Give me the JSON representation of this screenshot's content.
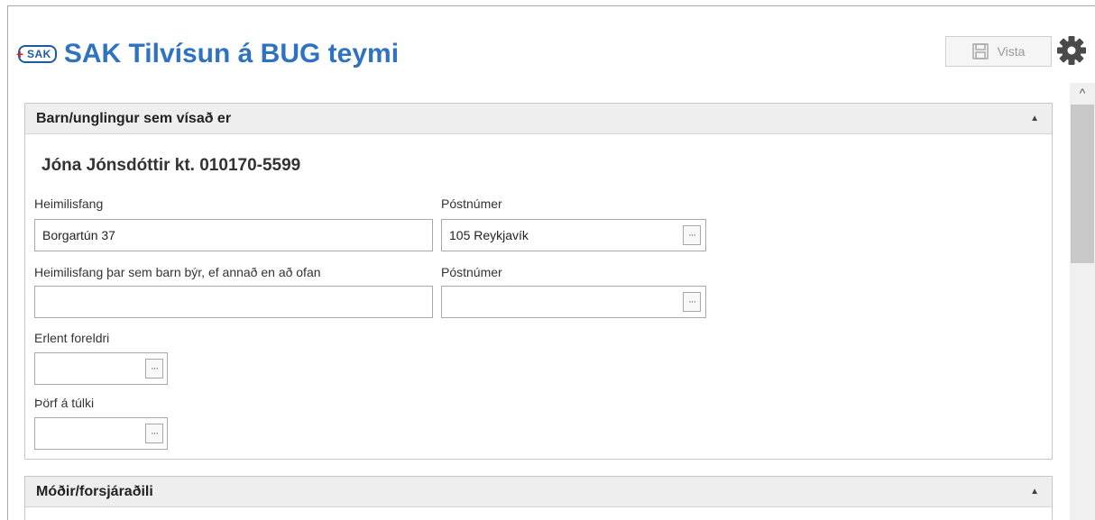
{
  "app": {
    "logo_text": "SAK",
    "logo_plus": "+",
    "title": "SAK Tilvísun á BUG teymi"
  },
  "toolbar": {
    "save_label": "Vista",
    "save_icon": "floppy-disk-icon",
    "settings_icon": "gear-icon"
  },
  "panels": [
    {
      "title": "Barn/unglingur sem vísað er",
      "collapse_icon": "▲",
      "person": "Jóna Jónsdóttir kt. 010170-5599",
      "fields": {
        "address_label": "Heimilisfang",
        "address_value": "Borgartún 37",
        "postal_label": "Póstnúmer",
        "postal_value": "105 Reykjavík",
        "alt_address_label": "Heimilisfang þar sem barn býr, ef annað en að ofan",
        "alt_address_value": "",
        "alt_postal_label": "Póstnúmer",
        "alt_postal_value": "",
        "foreign_parent_label": "Erlent foreldri",
        "foreign_parent_value": "",
        "interpreter_label": "Þörf á túlki",
        "interpreter_value": ""
      },
      "lookup_label": "···"
    },
    {
      "title": "Móðir/forsjáraðili",
      "collapse_icon": "▲"
    }
  ],
  "scrollbar": {
    "up_arrow": "^"
  }
}
